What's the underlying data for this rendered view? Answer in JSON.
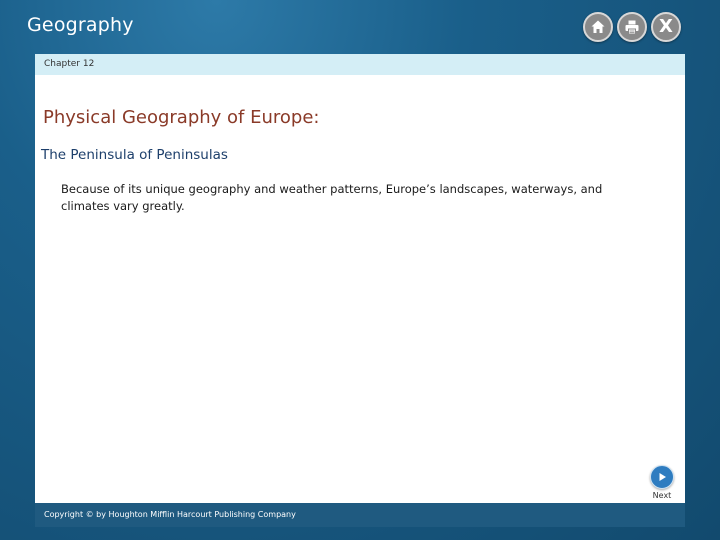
{
  "header": {
    "app_title": "Geography",
    "icons": [
      "home-icon",
      "print-icon",
      "close-icon"
    ],
    "close_glyph": "X"
  },
  "chapter": {
    "label": "Chapter 12"
  },
  "slide": {
    "title": "Physical Geography of Europe:",
    "subtitle": "The Peninsula of Peninsulas",
    "body": "Because of its unique geography and weather patterns, Europe’s landscapes, waterways, and climates vary greatly."
  },
  "navigation": {
    "next_label": "Next",
    "next_icon": "play-arrow-icon"
  },
  "footer": {
    "copyright": "Copyright © by Houghton Mifflin Harcourt Publishing Company"
  },
  "colors": {
    "frame": "#1a5f8a",
    "chapter_bar": "#d4eef6",
    "title": "#8a3a28",
    "subtitle": "#1d3f6b",
    "footer": "#1f5a80",
    "next_button": "#2e7cc0"
  }
}
